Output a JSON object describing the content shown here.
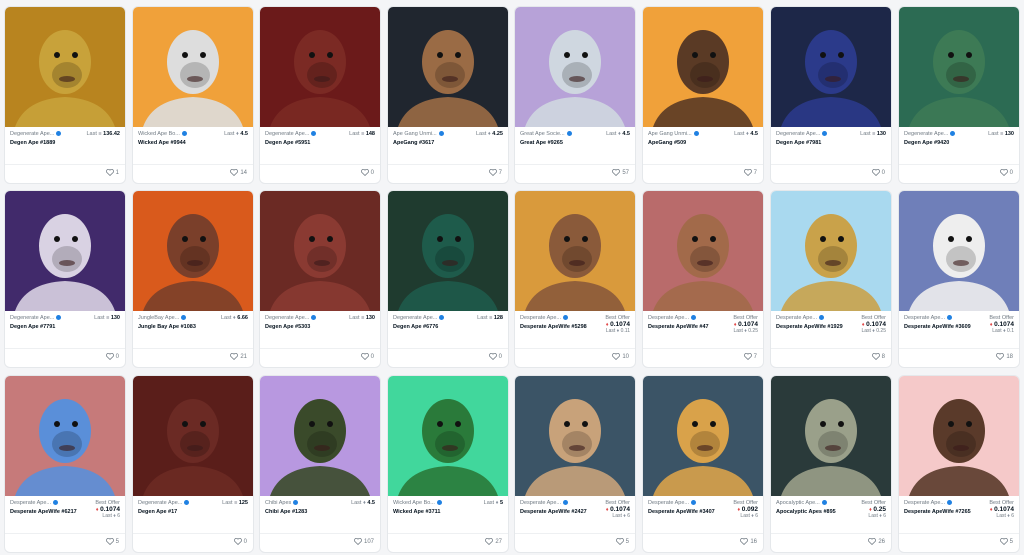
{
  "cards": [
    {
      "collection": "Degenerate Ape...",
      "name": "Degen Ape #1889",
      "mode": "last",
      "last_price": "136.42",
      "currency": "sol",
      "likes": "1",
      "bg": "#b8841f",
      "char": "#c8a23a"
    },
    {
      "collection": "Wicked Ape Bo...",
      "name": "Wicked Ape #9944",
      "mode": "last",
      "last_price": "4.5",
      "currency": "eth",
      "likes": "14",
      "bg": "#f0a13a",
      "char": "#ddd"
    },
    {
      "collection": "Degenerate Ape...",
      "name": "Degen Ape #5951",
      "mode": "last",
      "last_price": "148",
      "currency": "sol",
      "likes": "0",
      "bg": "#6b1a1a",
      "char": "#7b2a24"
    },
    {
      "collection": "Ape Gang Unmi...",
      "name": "ApeGang #3617",
      "mode": "last",
      "last_price": "4.25",
      "currency": "eth",
      "likes": "7",
      "bg": "#20262f",
      "char": "#9a6b45"
    },
    {
      "collection": "Great Ape Socie...",
      "name": "Great Ape #9265",
      "mode": "last",
      "last_price": "4.5",
      "currency": "eth",
      "likes": "57",
      "bg": "#b7a2d8",
      "char": "#cfd7e0"
    },
    {
      "collection": "Ape Gang Unmi...",
      "name": "ApeGang #509",
      "mode": "last",
      "last_price": "4.5",
      "currency": "eth",
      "likes": "7",
      "bg": "#f0a13a",
      "char": "#5a3a25"
    },
    {
      "collection": "Degenerate Ape...",
      "name": "Degen Ape #7981",
      "mode": "last",
      "last_price": "130",
      "currency": "sol",
      "likes": "0",
      "bg": "#1d2748",
      "char": "#2b3a8a"
    },
    {
      "collection": "Degenerate Ape...",
      "name": "Degen Ape #9420",
      "mode": "last",
      "last_price": "130",
      "currency": "sol",
      "likes": "0",
      "bg": "#2c6b53",
      "char": "#3d7a55"
    },
    {
      "collection": "Degenerate Ape...",
      "name": "Degen Ape #7791",
      "mode": "last",
      "last_price": "130",
      "currency": "sol",
      "likes": "0",
      "bg": "#412a6b",
      "char": "#d9d2e3"
    },
    {
      "collection": "JungleBay Ape...",
      "name": "Jungle Bay Ape #1083",
      "mode": "last",
      "last_price": "6.66",
      "currency": "eth",
      "likes": "21",
      "bg": "#d95a1c",
      "char": "#7a3f2a"
    },
    {
      "collection": "Degenerate Ape...",
      "name": "Degen Ape #5303",
      "mode": "last",
      "last_price": "130",
      "currency": "sol",
      "likes": "0",
      "bg": "#6b2a24",
      "char": "#8a3a32"
    },
    {
      "collection": "Degenerate Ape...",
      "name": "Degen Ape #6776",
      "mode": "last",
      "last_price": "128",
      "currency": "sol",
      "likes": "0",
      "bg": "#1f3b2f",
      "char": "#1e5b4b"
    },
    {
      "collection": "Desperate Ape...",
      "name": "Desperate ApeWife #5298",
      "mode": "offer",
      "offer_label": "Best Offer",
      "offer": "0.1074",
      "last_price": "0.11",
      "likes": "10",
      "bg": "#d99a3c",
      "char": "#8a5a3a"
    },
    {
      "collection": "Desperate Ape...",
      "name": "Desperate ApeWife #47",
      "mode": "offer",
      "offer_label": "Best Offer",
      "offer": "0.1074",
      "last_price": "0.25",
      "likes": "7",
      "bg": "#b96b6b",
      "char": "#a26a4a"
    },
    {
      "collection": "Desperate Ape...",
      "name": "Desperate ApeWife #1929",
      "mode": "offer",
      "offer_label": "Best Offer",
      "offer": "0.1074",
      "last_price": "0.25",
      "likes": "8",
      "bg": "#a9d9ef",
      "char": "#c9a24a"
    },
    {
      "collection": "Desperate Ape...",
      "name": "Desperate ApeWife #3609",
      "mode": "offer",
      "offer_label": "Best Offer",
      "offer": "0.1074",
      "last_price": "0.1",
      "likes": "18",
      "bg": "#6f7fb9",
      "char": "#eee"
    },
    {
      "collection": "Desperate Ape...",
      "name": "Desperate ApeWife #6217",
      "mode": "offer",
      "offer_label": "Best Offer",
      "offer": "0.1074",
      "last_price": "6",
      "likes": "5",
      "bg": "#c67a7a",
      "char": "#5a8fd9"
    },
    {
      "collection": "Degenerate Ape...",
      "name": "Degen Ape #17",
      "mode": "last",
      "last_price": "125",
      "currency": "sol",
      "likes": "0",
      "bg": "#5a1e1a",
      "char": "#6b2a24"
    },
    {
      "collection": "Chibi Apes",
      "name": "Chibi Ape #1283",
      "mode": "last",
      "last_price": "4.5",
      "currency": "eth",
      "likes": "107",
      "bg": "#b898e0",
      "char": "#3a4a2a"
    },
    {
      "collection": "Wicked Ape Bo...",
      "name": "Wicked Ape #3711",
      "mode": "last",
      "last_price": "5",
      "currency": "eth",
      "likes": "27",
      "bg": "#41d79c",
      "char": "#2a7a3a"
    },
    {
      "collection": "Desperate Ape...",
      "name": "Desperate ApeWife #2427",
      "mode": "offer",
      "offer_label": "Best Offer",
      "offer": "0.1074",
      "last_price": "6",
      "likes": "5",
      "bg": "#3b5466",
      "char": "#c8a27a"
    },
    {
      "collection": "Desperate Ape...",
      "name": "Desperate ApeWife #3407",
      "mode": "offer",
      "offer_label": "Best Offer",
      "offer": "0.092",
      "last_price": "6",
      "likes": "16",
      "bg": "#3b5466",
      "char": "#d9a24a"
    },
    {
      "collection": "Apocalyptic Ape...",
      "name": "Apocalyptic Apes #895",
      "mode": "offer",
      "offer_label": "Best Offer",
      "offer": "0.25",
      "last_price": "6",
      "likes": "26",
      "bg": "#2a3a3a",
      "char": "#9aa08a"
    },
    {
      "collection": "Desperate Ape...",
      "name": "Desperate ApeWife #7265",
      "mode": "offer",
      "offer_label": "Best Offer",
      "offer": "0.1074",
      "last_price": "6",
      "likes": "5",
      "bg": "#f5c9c9",
      "char": "#5a3a2a"
    }
  ],
  "labels": {
    "last": "Last"
  }
}
